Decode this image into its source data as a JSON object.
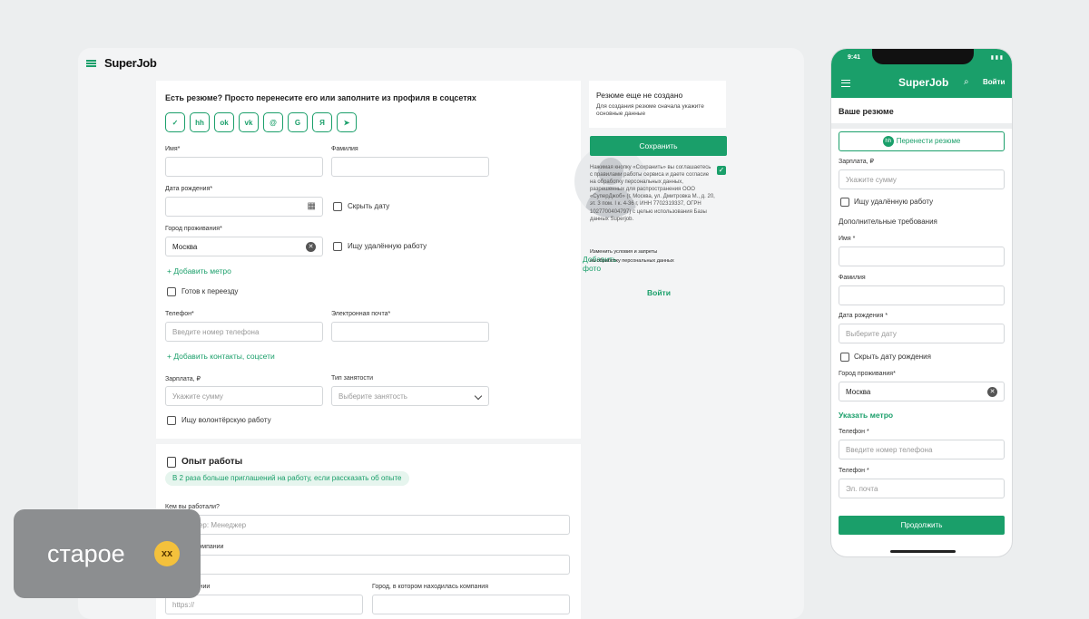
{
  "brand": {
    "logo": "SuperJob",
    "accent": "#1a9f6a"
  },
  "desktop": {
    "import_title": "Есть резюме? Просто перенесите его или заполните из профиля в соцсетях",
    "socials": [
      "✓",
      "hh",
      "ok",
      "vk",
      "@",
      "G",
      "Я",
      "➤"
    ],
    "first_name_label": "Имя*",
    "last_name_label": "Фамилия",
    "birth_label": "Дата рождения*",
    "hide_date": "Скрыть дату",
    "city_label": "Город проживания*",
    "city_value": "Москва",
    "remote": "Ищу удалённую работу",
    "add_metro": "+ Добавить метро",
    "relocate": "Готов к переезду",
    "phone_label": "Телефон*",
    "phone_placeholder": "Введите номер телефона",
    "email_label": "Электронная почта*",
    "add_contacts": "+ Добавить контакты, соцсети",
    "salary_label": "Зарплата, ₽",
    "salary_placeholder": "Укажите сумму",
    "employment_label": "Тип занятости",
    "employment_placeholder": "Выберите занятость",
    "volunteer": "Ищу волонтёрскую работу",
    "add_photo": "Добавить фото",
    "exp_title": "Опыт работы",
    "exp_hint": "В 2 раза больше приглашений на работу, если рассказать об опыте",
    "who_label": "Кем вы работали?",
    "who_placeholder": "Например: Менеджер",
    "company_label": "Название компании",
    "site_label": "Сайт компании",
    "site_placeholder": "https://",
    "company_city_label": "Город, в котором находилась компания"
  },
  "side": {
    "status_title": "Резюме еще не создано",
    "status_text": "Для создания резюме сначала укажите основные данные",
    "save": "Сохранить",
    "consent": "Нажимая кнопку «Сохранить» вы соглашаетесь с правилами работы сервиса и даете согласие на обработку персональных данных, разрешенных для распространения ООО «СуперДжоб» (г. Москва, ул. Дмитровка М., д. 20, эт. 3 пом. I к. 4-36 г, ИНН 7702319337, ОГРН 1027700404797) с целью использования Базы данных Superjob.",
    "change_terms": "Изменить условия и запреты",
    "change_terms2": "на обработку персональных данных",
    "login": "Войти"
  },
  "phone": {
    "time": "9:41",
    "status": "▮ ▮ ▮",
    "logo": "SuperJob",
    "login": "Войти",
    "title": "Ваше резюме",
    "transfer": "Перенести резюме",
    "salary_label": "Зарплата, ₽",
    "salary_placeholder": "Укажите сумму",
    "remote": "Ищу удалённую работу",
    "extra": "Дополнительные требования",
    "name_label": "Имя *",
    "last_label": "Фамилия",
    "birth_label": "Дата рождения *",
    "birth_placeholder": "Выберите дату",
    "hide_birth": "Скрыть дату рождения",
    "city_label": "Город проживания*",
    "city_value": "Москва",
    "metro": "Указать метро",
    "phone_label": "Телефон *",
    "phone_placeholder": "Введите номер телефона",
    "email_label": "Телефон *",
    "email_placeholder": "Эл. почта",
    "continue": "Продолжить"
  },
  "badge": {
    "text": "старое",
    "emoji": "xx"
  }
}
